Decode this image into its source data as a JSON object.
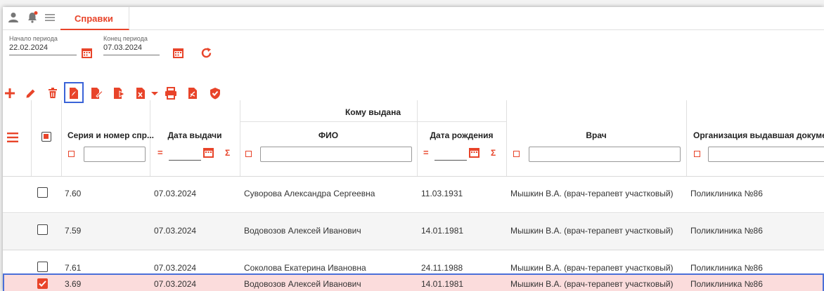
{
  "tab": {
    "label": "Справки"
  },
  "period": {
    "start_label": "Начало периода",
    "start_value": "22.02.2024",
    "end_label": "Конец периода",
    "end_value": "07.03.2024"
  },
  "columns": {
    "group": "Кому выдана",
    "series": "Серия и номер спр...",
    "issue_date": "Дата выдачи",
    "fio": "ФИО",
    "birth_date": "Дата рождения",
    "doctor": "Врач",
    "org": "Организация выдавшая документ"
  },
  "filter": {
    "eq": "=",
    "sum": "Σ"
  },
  "rows": [
    {
      "series": "7.60",
      "issue_date": "07.03.2024",
      "fio": "Суворова Александра Сергеевна",
      "birth_date": "11.03.1931",
      "doctor": "Мышкин В.А. (врач-терапевт участковый)",
      "org": "Поликлиника №86",
      "checked": false
    },
    {
      "series": "7.59",
      "issue_date": "07.03.2024",
      "fio": "Водовозов Алексей Иванович",
      "birth_date": "14.01.1981",
      "doctor": "Мышкин В.А. (врач-терапевт участковый)",
      "org": "Поликлиника №86",
      "checked": false
    },
    {
      "series": "7.61",
      "issue_date": "07.03.2024",
      "fio": "Соколова Екатерина Ивановна",
      "birth_date": "24.11.1988",
      "doctor": "Мышкин В.А. (врач-терапевт участковый)",
      "org": "Поликлиника №86",
      "checked": false
    },
    {
      "series": "3.69",
      "issue_date": "07.03.2024",
      "fio": "Водовозов Алексей Иванович",
      "birth_date": "14.01.1981",
      "doctor": "Мышкин В.А. (врач-терапевт участковый)",
      "org": "Поликлиника №86",
      "checked": true
    }
  ],
  "icons": [
    "user-icon",
    "bell-icon",
    "menu-icon",
    "calendar-icon",
    "refresh-icon",
    "add-icon",
    "edit-icon",
    "delete-icon",
    "pdf-icon",
    "sign-document-icon",
    "export-icon",
    "excel-icon",
    "print-icon",
    "acrobat-icon",
    "shield-check-icon"
  ],
  "colors": {
    "accent": "#e8442a",
    "selected_row": "#fbdcdc",
    "selected_border": "#4a6fd8",
    "row_alt": "#f5f5f5"
  }
}
